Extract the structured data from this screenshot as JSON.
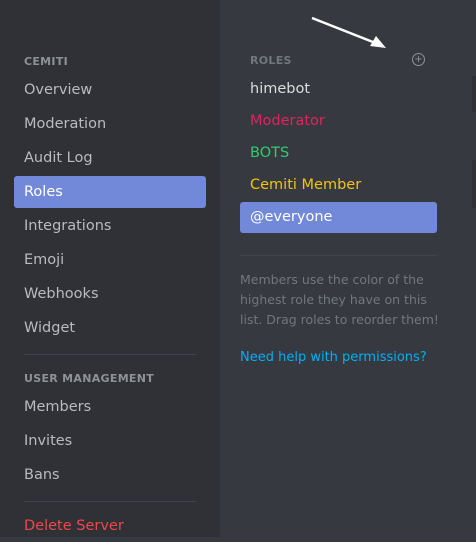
{
  "sidebar": {
    "server_header": "CEMITI",
    "server_items": [
      {
        "label": "Overview"
      },
      {
        "label": "Moderation"
      },
      {
        "label": "Audit Log"
      },
      {
        "label": "Roles",
        "selected": true
      },
      {
        "label": "Integrations"
      },
      {
        "label": "Emoji"
      },
      {
        "label": "Webhooks"
      },
      {
        "label": "Widget"
      }
    ],
    "user_header": "USER MANAGEMENT",
    "user_items": [
      {
        "label": "Members"
      },
      {
        "label": "Invites"
      },
      {
        "label": "Bans"
      }
    ],
    "delete_label": "Delete Server"
  },
  "roles": {
    "header": "ROLES",
    "add_icon": "plus-circle-icon",
    "items": [
      {
        "label": "himebot",
        "color": "#dcddde"
      },
      {
        "label": "Moderator",
        "color": "#e0245e"
      },
      {
        "label": "BOTS",
        "color": "#2ecc71"
      },
      {
        "label": "Cemiti Member",
        "color": "#f1c40f"
      },
      {
        "label": "@everyone",
        "color": "#ffffff",
        "selected": true
      }
    ],
    "help_text": "Members use the color of the highest role they have on this list. Drag roles to reorder them!",
    "help_link": "Need help with permissions?"
  },
  "colors": {
    "accent": "#7289da",
    "danger": "#f04747",
    "link": "#00b0f4"
  },
  "annotation": {
    "icon": "arrow-pointer-icon"
  }
}
